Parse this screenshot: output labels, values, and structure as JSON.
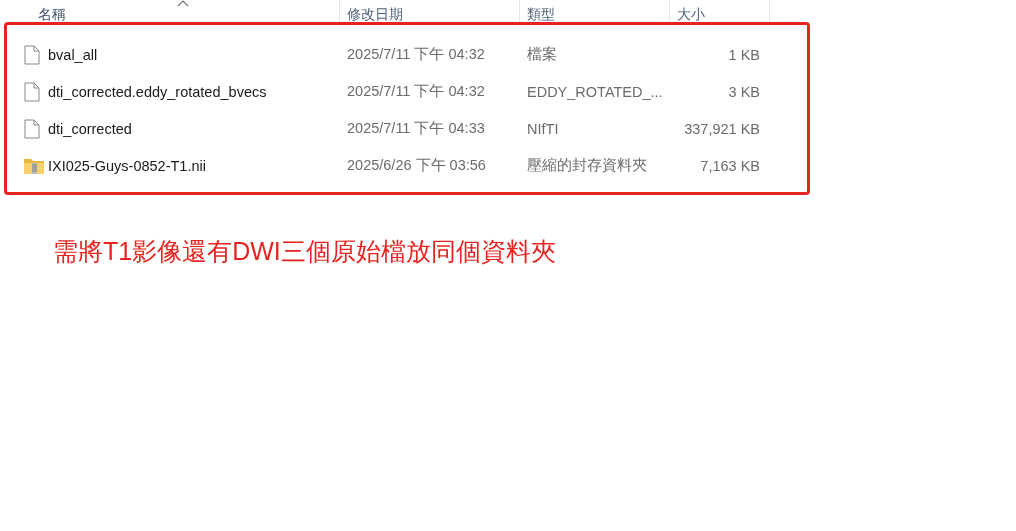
{
  "columns": [
    {
      "label": "名稱",
      "sorted": true
    },
    {
      "label": "修改日期",
      "sorted": false
    },
    {
      "label": "類型",
      "sorted": false
    },
    {
      "label": "大小",
      "sorted": false
    }
  ],
  "files": [
    {
      "kind": "file",
      "name": "bval_all",
      "modified": "2025/7/11 下午 04:32",
      "type": "檔案",
      "size": "1 KB"
    },
    {
      "kind": "file",
      "name": "dti_corrected.eddy_rotated_bvecs",
      "modified": "2025/7/11 下午 04:32",
      "type": "EDDY_ROTATED_...",
      "size": "3 KB"
    },
    {
      "kind": "file",
      "name": "dti_corrected",
      "modified": "2025/7/11 下午 04:33",
      "type": "NIfTI",
      "size": "337,921 KB"
    },
    {
      "kind": "zip",
      "name": "IXI025-Guys-0852-T1.nii",
      "modified": "2025/6/26 下午 03:56",
      "type": "壓縮的封存資料夾",
      "size": "7,163 KB"
    }
  ],
  "annotation": "需將T1影像還有DWI三個原始檔放同個資料夾"
}
